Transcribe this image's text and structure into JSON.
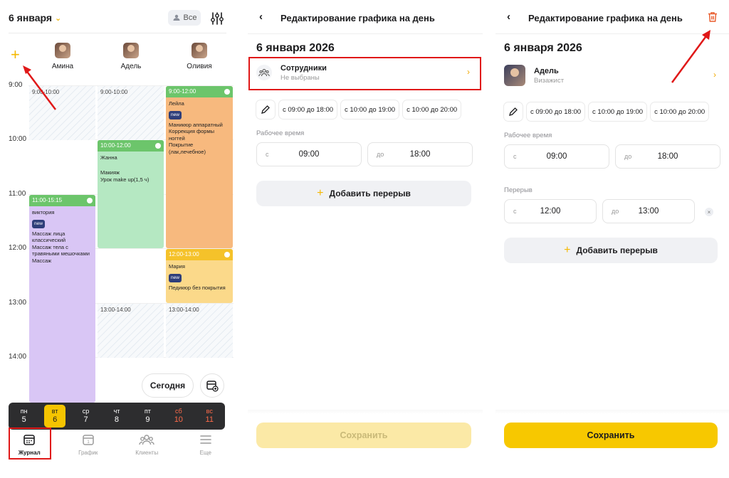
{
  "journal": {
    "date_label": "6 января",
    "all_filter_label": "Все",
    "staff": [
      {
        "name": "Амина"
      },
      {
        "name": "Адель"
      },
      {
        "name": "Оливия"
      }
    ],
    "hours": [
      "9:00",
      "10:00",
      "11:00",
      "12:00",
      "13:00",
      "14:00"
    ],
    "free_slots": [
      {
        "label": "9:00-10:00"
      },
      {
        "label": "9:00-10:00"
      },
      {
        "label": "13:00-14:00"
      },
      {
        "label": "13:00-14:00"
      }
    ],
    "appointments": [
      {
        "time": "11:00-15:15",
        "client": "виктория",
        "badge": "new",
        "services": "Массаж лица классический\nМассаж тела с травяными мешочками\nМассаж",
        "header_color": "#6cc56b",
        "body_color": "#d9c6f5"
      },
      {
        "time": "10:00-12:00",
        "client": "Жанна",
        "badge": "",
        "services": "Макияж\nУрок make up(1,5 ч)",
        "header_color": "#6cc56b",
        "body_color": "#b5e8c2"
      },
      {
        "time": "9:00-12:00",
        "client": "Лейла",
        "badge": "new",
        "services": "Маникюр аппаратный\nКоррекция формы ногтей\nПокрытие (лак,лечебное)",
        "header_color": "#6cc56b",
        "body_color": "#f7b97e"
      },
      {
        "time": "12:00-13:00",
        "client": "Мария",
        "badge": "new",
        "services": "Педикюр без покрытия",
        "header_color": "#f5c22a",
        "body_color": "#fbd98a"
      }
    ],
    "today_label": "Сегодня",
    "week": [
      {
        "dow": "пн",
        "num": "5"
      },
      {
        "dow": "вт",
        "num": "6"
      },
      {
        "dow": "ср",
        "num": "7"
      },
      {
        "dow": "чт",
        "num": "8"
      },
      {
        "dow": "пт",
        "num": "9"
      },
      {
        "dow": "сб",
        "num": "10"
      },
      {
        "dow": "вс",
        "num": "11"
      }
    ],
    "tabs": [
      {
        "label": "Журнал",
        "icon": "calendar-icon"
      },
      {
        "label": "График",
        "icon": "schedule-icon"
      },
      {
        "label": "Клиенты",
        "icon": "clients-icon"
      },
      {
        "label": "Еще",
        "icon": "menu-icon"
      }
    ]
  },
  "edit_empty": {
    "title": "Редактирование графика на день",
    "date": "6 января 2026",
    "employee_title": "Сотрудники",
    "employee_sub": "Не выбраны",
    "presets": [
      "с 09:00 до 18:00",
      "с 10:00 до 19:00",
      "с 10:00 до 20:00"
    ],
    "work_time_label": "Рабочее время",
    "from_prefix": "с",
    "to_prefix": "до",
    "from_value": "09:00",
    "to_value": "18:00",
    "add_break": "Добавить перерыв",
    "save": "Сохранить"
  },
  "edit_filled": {
    "title": "Редактирование графика на день",
    "date": "6 января 2026",
    "employee_name": "Адель",
    "employee_role": "Визажист",
    "presets": [
      "с 09:00 до 18:00",
      "с 10:00 до 19:00",
      "с 10:00 до 20:00"
    ],
    "work_time_label": "Рабочее время",
    "from_prefix": "с",
    "to_prefix": "до",
    "from_value": "09:00",
    "to_value": "18:00",
    "break_label": "Перерыв",
    "break_from": "12:00",
    "break_to": "13:00",
    "add_break": "Добавить перерыв",
    "save": "Сохранить"
  },
  "colors": {
    "accent": "#f7c800",
    "annotation": "#e01818"
  }
}
